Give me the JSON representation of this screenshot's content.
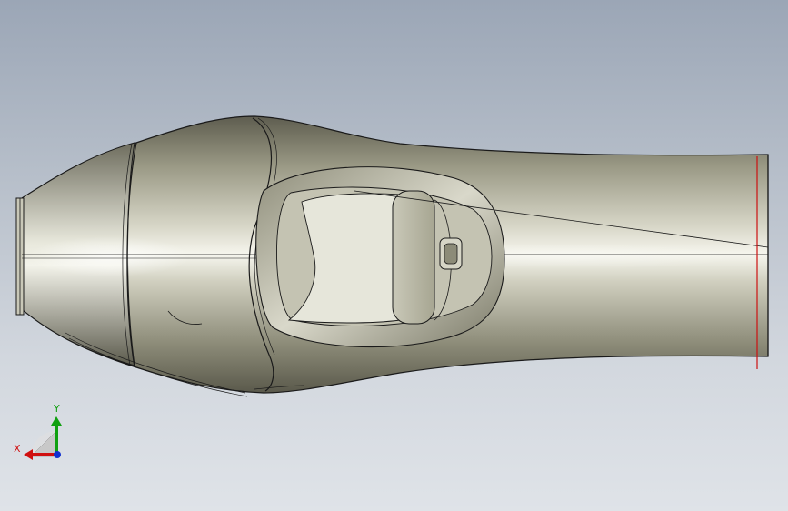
{
  "viewport": {
    "background_top": "#9ba6b6",
    "background_bottom": "#dfe3e8"
  },
  "model": {
    "body_color": "#a8a793",
    "edge_color": "#1a1a1a",
    "reference_line_color": "#cc1111"
  },
  "triad": {
    "x_label": "X",
    "y_label": "Y",
    "x_color": "#d01010",
    "y_color": "#10a010",
    "z_color": "#1030d0"
  }
}
